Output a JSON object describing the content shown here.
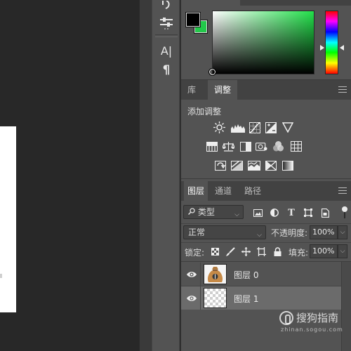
{
  "colors": {
    "foreground": "#000000",
    "background": "#22c94a",
    "panel": "#535353",
    "tab_bar": "#424242",
    "selected_layer": "#6b6b6b"
  },
  "tool_strip": {
    "icons": [
      "brush-settings-icon",
      "properties-sliders-icon",
      "character-icon",
      "paragraph-icon"
    ],
    "character_label": "A|",
    "paragraph_label": "¶"
  },
  "adjustments_panel": {
    "tabs": [
      {
        "label": "库",
        "active": false
      },
      {
        "label": "调整",
        "active": true
      }
    ],
    "title": "添加调整",
    "icons_row1": [
      "brightness-icon",
      "levels-icon",
      "curves-icon",
      "exposure-icon",
      "vibrance-icon"
    ],
    "icons_row2": [
      "hue-saturation-icon",
      "color-balance-icon",
      "black-white-icon",
      "photo-filter-icon",
      "channel-mixer-icon",
      "color-lookup-icon"
    ],
    "icons_row3": [
      "invert-icon",
      "posterize-icon",
      "threshold-icon",
      "selective-color-icon",
      "gradient-map-icon"
    ]
  },
  "layers_panel": {
    "tabs": [
      {
        "label": "图层",
        "active": true
      },
      {
        "label": "通道",
        "active": false
      },
      {
        "label": "路径",
        "active": false
      }
    ],
    "filter": {
      "label": "类型",
      "icon": "search-icon"
    },
    "filter_icons": [
      "image-filter-icon",
      "adjustment-filter-icon",
      "type-filter-icon",
      "shape-filter-icon",
      "smart-object-filter-icon"
    ],
    "type_icon_label": "T",
    "blend_mode": "正常",
    "opacity_label": "不透明度:",
    "opacity_value": "100%",
    "lock_label": "锁定:",
    "lock_icons": [
      "lock-transparent-icon",
      "lock-image-icon",
      "lock-position-icon",
      "lock-artboard-icon",
      "lock-all-icon"
    ],
    "fill_label": "填充:",
    "fill_value": "100%",
    "layers": [
      {
        "name": "图层 0",
        "visible": true,
        "selected": false,
        "thumbnail": "money-bag"
      },
      {
        "name": "图层 1",
        "visible": true,
        "selected": true,
        "thumbnail": "transparent"
      }
    ]
  },
  "watermark": {
    "text": "搜狗指南",
    "url_text": "zhinan.sogou.com"
  }
}
